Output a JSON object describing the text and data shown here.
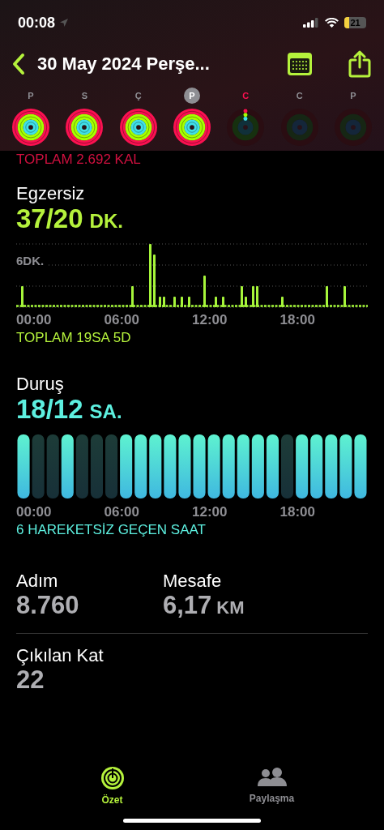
{
  "status_bar": {
    "time": "00:08",
    "battery": "21"
  },
  "header": {
    "title": "30 May 2024 Perşe..."
  },
  "week": [
    {
      "label": "P",
      "selected": false,
      "today": false,
      "kind": "complete"
    },
    {
      "label": "S",
      "selected": false,
      "today": false,
      "kind": "complete"
    },
    {
      "label": "Ç",
      "selected": false,
      "today": false,
      "kind": "complete"
    },
    {
      "label": "P",
      "selected": true,
      "today": false,
      "kind": "complete"
    },
    {
      "label": "C",
      "selected": false,
      "today": true,
      "kind": "started"
    },
    {
      "label": "C",
      "selected": false,
      "today": false,
      "kind": "empty"
    },
    {
      "label": "P",
      "selected": false,
      "today": false,
      "kind": "empty"
    }
  ],
  "move": {
    "total": "TOPLAM 2.692 KAL"
  },
  "exercise": {
    "title": "Egzersiz",
    "value": "37/20",
    "unit": "DK.",
    "gridline_label": "6DK.",
    "axis": [
      "00:00",
      "06:00",
      "12:00",
      "18:00"
    ],
    "total": "TOPLAM 19SA 5D"
  },
  "stand": {
    "title": "Duruş",
    "value": "18/12",
    "unit": "SA.",
    "axis": [
      "00:00",
      "06:00",
      "12:00",
      "18:00"
    ],
    "footer": "6 HAREKETSİZ GEÇEN SAAT",
    "hours": [
      {
        "stood": true
      },
      {
        "stood": false
      },
      {
        "stood": false
      },
      {
        "stood": true
      },
      {
        "stood": false
      },
      {
        "stood": false
      },
      {
        "stood": false
      },
      {
        "stood": true
      },
      {
        "stood": true
      },
      {
        "stood": true
      },
      {
        "stood": true
      },
      {
        "stood": true
      },
      {
        "stood": true
      },
      {
        "stood": true
      },
      {
        "stood": true
      },
      {
        "stood": true
      },
      {
        "stood": true
      },
      {
        "stood": true
      },
      {
        "stood": false
      },
      {
        "stood": true
      },
      {
        "stood": true
      },
      {
        "stood": true
      },
      {
        "stood": true
      },
      {
        "stood": true
      }
    ]
  },
  "stats": [
    {
      "label": "Adım",
      "value": "8.760"
    },
    {
      "label": "Mesafe",
      "value": "6,17",
      "unit": "KM"
    },
    {
      "label": "Çıkılan Kat",
      "value": "22"
    }
  ],
  "tabs": [
    {
      "label": "Özet",
      "selected": true,
      "kind": "summary"
    },
    {
      "label": "Paylaşma",
      "selected": false,
      "kind": "sharing"
    }
  ]
}
